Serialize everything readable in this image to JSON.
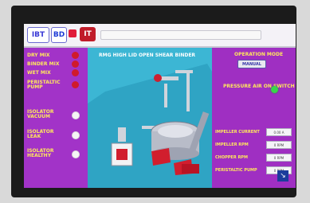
{
  "header": {
    "logos": [
      "IBT",
      "BD",
      "IT"
    ]
  },
  "left_panel": {
    "items": [
      {
        "label": "DRY MIX",
        "lamp": "red"
      },
      {
        "label": "BINDER MIX",
        "lamp": "red"
      },
      {
        "label": "WET MIX",
        "lamp": "red"
      },
      {
        "label": "PERISTALTIC PUMP",
        "lamp": "red"
      },
      {
        "label": "ISOLATOR VACUUM",
        "lamp": "white"
      },
      {
        "label": "ISOLATOR LEAK",
        "lamp": "white"
      },
      {
        "label": "ISOLATOR HEALTHY",
        "lamp": "white"
      }
    ]
  },
  "mimic": {
    "title": "RMG HIGH LID OPEN SHEAR BINDER"
  },
  "right_panel": {
    "status_label": "OPERATION MODE",
    "mode_button": "MANUAL",
    "switch_label": "PRESSURE AIR ON SWITCH",
    "readings": [
      {
        "label": "IMPELLER CURRENT",
        "value": "0.00 A"
      },
      {
        "label": "IMPELLER RPM",
        "value": "0 RPM"
      },
      {
        "label": "CHOPPER RPM",
        "value": "0 RPM"
      },
      {
        "label": "PERISTALTIC PUMP",
        "value": "0 RPM"
      }
    ]
  }
}
